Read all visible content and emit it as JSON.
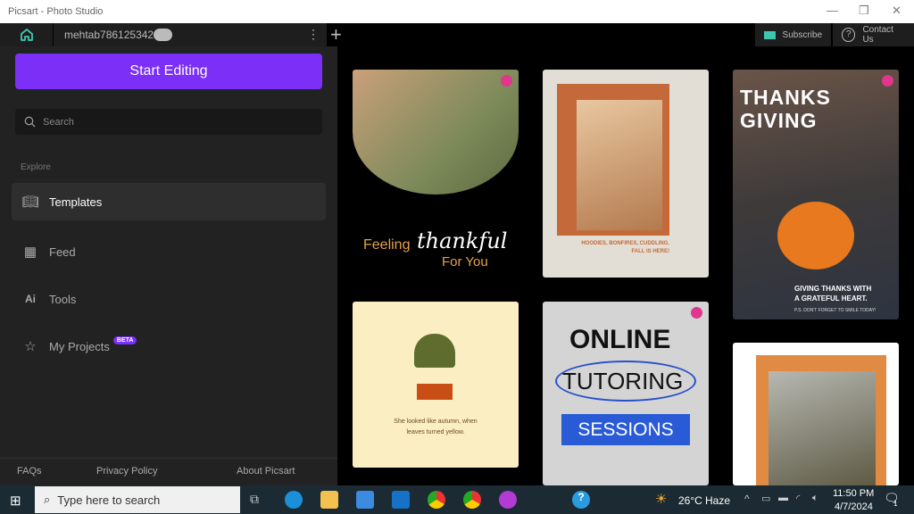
{
  "window": {
    "title": "Picsart - Photo Studio",
    "minimize": "—",
    "maximize": "❐",
    "close": "✕"
  },
  "tabbar": {
    "username": "mehtab786125342",
    "menu": "⋮",
    "new_tab": "+",
    "subscribe": "Subscribe",
    "contact": "Contact Us"
  },
  "sidebar": {
    "start_editing": "Start Editing",
    "search_placeholder": "Search",
    "explore": "Explore",
    "items": [
      {
        "label": "Templates",
        "icon": "book-icon"
      },
      {
        "label": "Feed",
        "icon": "grid-icon"
      },
      {
        "label": "Tools",
        "icon": "ai-icon",
        "icon_text": "Ai"
      },
      {
        "label": "My Projects",
        "icon": "star-icon",
        "badge": "BETA"
      }
    ],
    "footer": [
      "FAQs",
      "Privacy Policy",
      "About Picsart"
    ]
  },
  "templates": [
    {
      "line1": "Feeling",
      "line2": "thankful",
      "line3": "For You",
      "premium": true
    },
    {
      "caption1": "HOODIES, BONFIRES, CUDDLING.",
      "caption2": "FALL IS HERE!"
    },
    {
      "title1": "THANKS",
      "title2": "GIVING",
      "sub1": "GIVING THANKS WITH",
      "sub2": "A GRATEFUL HEART.",
      "note": "P.S. DON'T FORGET TO SMILE TODAY!",
      "premium": true
    },
    {
      "caption1": "She looked like autumn, when",
      "caption2": "leaves turned yellow."
    },
    {
      "t1": "ONLINE",
      "t2": "TUTORING",
      "t3": "SESSIONS",
      "premium": true
    },
    {}
  ],
  "taskbar": {
    "search_placeholder": "Type here to search",
    "temperature": "26°C",
    "weather": "Haze",
    "time": "11:50 PM",
    "date": "4/7/2024",
    "notifications": "1"
  },
  "colors": {
    "accent": "#7b2ff7",
    "premium": "#e0368c",
    "home": "#3ec7b0"
  }
}
